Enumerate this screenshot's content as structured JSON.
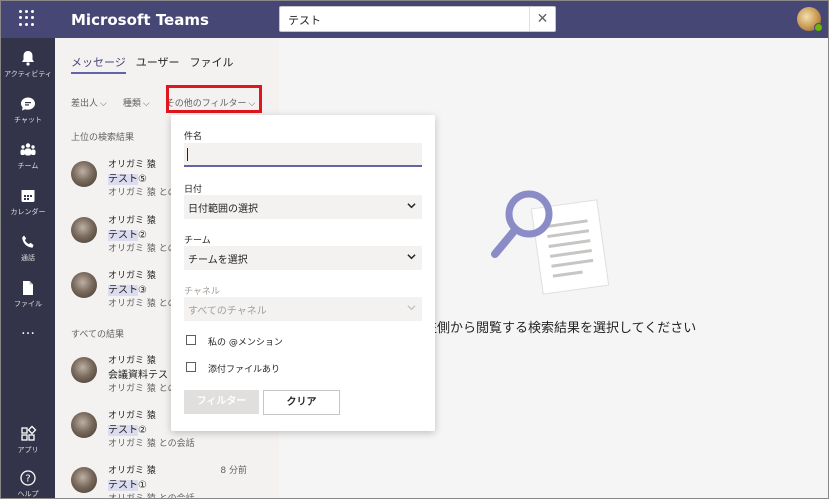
{
  "app": {
    "title": "Microsoft Teams"
  },
  "search": {
    "value": "テスト",
    "clear_glyph": "✕"
  },
  "rail": [
    {
      "label": "アクティビティ",
      "icon": "bell-icon"
    },
    {
      "label": "チャット",
      "icon": "chat-icon"
    },
    {
      "label": "チーム",
      "icon": "teams-icon"
    },
    {
      "label": "カレンダー",
      "icon": "calendar-icon"
    },
    {
      "label": "通話",
      "icon": "phone-icon"
    },
    {
      "label": "ファイル",
      "icon": "file-icon"
    },
    {
      "label": "…",
      "icon": "more-icon"
    },
    {
      "label": "アプリ",
      "icon": "apps-icon"
    },
    {
      "label": "ヘルプ",
      "icon": "help-icon"
    }
  ],
  "tabs": [
    {
      "label": "メッセージ",
      "active": true
    },
    {
      "label": "ユーザー",
      "active": false
    },
    {
      "label": "ファイル",
      "active": false
    }
  ],
  "filters": [
    {
      "label": "差出人"
    },
    {
      "label": "種類"
    },
    {
      "label": "その他のフィルター"
    }
  ],
  "sections": {
    "top": "上位の検索結果",
    "all": "すべての結果"
  },
  "top_results": [
    {
      "who": "オリガミ 猿",
      "title_hl": "テスト",
      "title_rest": "⑤",
      "ctx": "オリガミ 猿 との会話"
    },
    {
      "who": "オリガミ 猿",
      "title_hl": "テスト",
      "title_rest": "②",
      "ctx": "オリガミ 猿 との会話"
    },
    {
      "who": "オリガミ 猿",
      "title_hl": "テスト",
      "title_rest": "③",
      "ctx": "オリガミ 猿 との会話"
    }
  ],
  "all_results": [
    {
      "who": "オリガミ 猿",
      "title_hl": "",
      "title_rest": "会議資料テス",
      "ctx": "オリガミ 猿 との会",
      "time": ""
    },
    {
      "who": "オリガミ 猿",
      "title_hl": "テスト",
      "title_rest": "②",
      "ctx": "オリガミ 猿 との会話",
      "time": ""
    },
    {
      "who": "オリガミ 猿",
      "title_hl": "テスト",
      "title_rest": "①",
      "ctx": "オリガミ 猿 との会話",
      "time": "8 分前"
    }
  ],
  "popup": {
    "subject_label": "件名",
    "subject_value": "",
    "date_label": "日付",
    "date_value": "日付範囲の選択",
    "team_label": "チーム",
    "team_value": "チームを選択",
    "channel_label": "チャネル",
    "channel_value": "すべてのチャネル",
    "mention_label": "私の @メンション",
    "attach_label": "添付ファイルあり",
    "filter_button": "フィルター",
    "clear_button": "クリア"
  },
  "main": {
    "empty_text": "左側から閲覧する検索結果を選択してください"
  },
  "colors": {
    "topbar": "#464775",
    "rail": "#33344a",
    "accent": "#6264a7",
    "highlight_box": "#e0161e"
  }
}
